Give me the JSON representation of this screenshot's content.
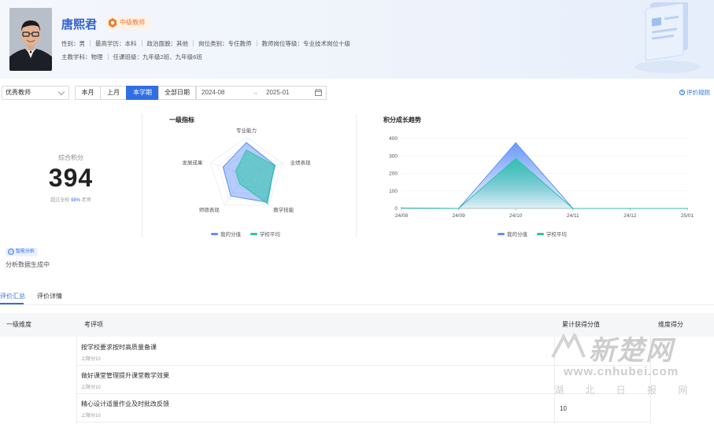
{
  "profile": {
    "name": "唐熙君",
    "badge": "中级教师",
    "row1": [
      "性别：男",
      "最高学历：本科",
      "政治面貌：其他",
      "岗位类别：专任教师",
      "教师岗位等级：专业技术岗位十级"
    ],
    "row2": [
      "主教学科：物理",
      "任课班级：九年级2班、九年级6班"
    ]
  },
  "filters": {
    "category": "优秀教师",
    "periods": [
      "本月",
      "上月",
      "本学期",
      "全部日期"
    ],
    "active_period": "本学期",
    "date_start": "2024-08",
    "date_sep": "→",
    "date_end": "2025-01",
    "rule_link": "评价规则"
  },
  "summary": {
    "label": "综合积分",
    "score": "394",
    "sub_prefix": "超过全校",
    "sub_pct": "98%",
    "sub_suffix": "老师"
  },
  "radar": {
    "title": "一级指标",
    "axes": [
      "专业能力",
      "业绩表现",
      "教学技能",
      "师德表现",
      "发展成果"
    ],
    "legend": [
      "我的分值",
      "学校平均"
    ]
  },
  "trend": {
    "title": "积分成长趋势",
    "legend": [
      "我的分值",
      "学校平均"
    ]
  },
  "chart_data": [
    {
      "type": "radar",
      "title": "一级指标",
      "axes": [
        "专业能力",
        "业绩表现",
        "教学技能",
        "师德表现",
        "发展成果"
      ],
      "series": [
        {
          "name": "我的分值",
          "values": [
            0.85,
            0.8,
            0.9,
            0.7,
            0.65
          ],
          "color": "#5b8ff9"
        },
        {
          "name": "学校平均",
          "values": [
            0.65,
            0.78,
            0.95,
            0.3,
            0.3
          ],
          "color": "#2cc3a6"
        }
      ]
    },
    {
      "type": "area",
      "title": "积分成长趋势",
      "x": [
        "24/08",
        "24/09",
        "24/10",
        "24/11",
        "24/12",
        "25/01"
      ],
      "series": [
        {
          "name": "我的分值",
          "values": [
            3,
            0,
            375,
            0,
            0,
            0
          ],
          "color": "#5b8ff9"
        },
        {
          "name": "学校平均",
          "values": [
            2,
            0,
            285,
            0,
            0,
            0
          ],
          "color": "#2cc3a6"
        }
      ],
      "ylim": [
        0,
        400
      ],
      "yticks": [
        "0",
        "100",
        "200",
        "300",
        "400"
      ]
    }
  ],
  "ai": {
    "tag": "智能分析",
    "text": "分析数据生成中"
  },
  "tabs": [
    "评价汇总",
    "评价详情"
  ],
  "table": {
    "headers": [
      "一级维度",
      "考评项",
      "累计获得分值",
      "维度得分"
    ],
    "rows": [
      {
        "item": "按学校要求按时高质量备课",
        "cap": "上限分10",
        "score": ""
      },
      {
        "item": "做好课堂管理提升课堂教学效果",
        "cap": "上限分10",
        "score": ""
      },
      {
        "item": "精心设计适量作业及时批改反馈",
        "cap": "上限分10",
        "score": "10"
      }
    ]
  },
  "watermark": {
    "brand": "新楚网",
    "url": "www.cnhubei.com",
    "sub": "湖 北 日 报 网"
  },
  "colors": {
    "primary": "#2f6fe4",
    "series1": "#5b8ff9",
    "series2": "#2cc3a6",
    "badge": "#ef7a2a"
  }
}
